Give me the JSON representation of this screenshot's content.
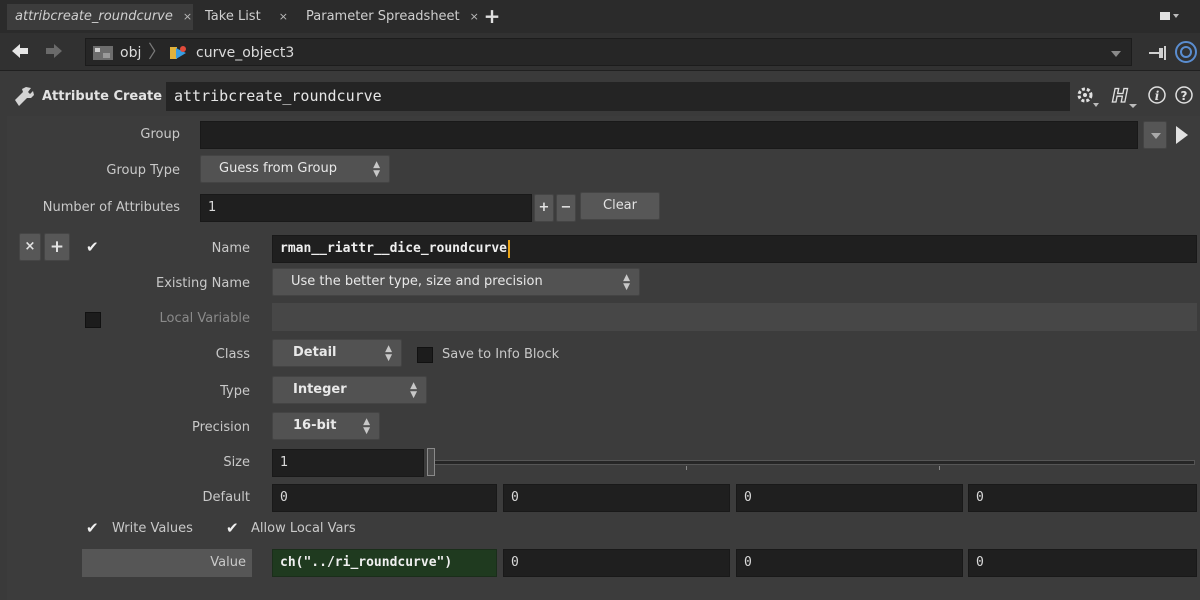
{
  "tabs": [
    {
      "label": "attribcreate_roundcurve",
      "active": true
    },
    {
      "label": "Take List",
      "active": false
    },
    {
      "label": "Parameter Spreadsheet",
      "active": false
    }
  ],
  "tab_close_glyph": "×",
  "tab_add_glyph": "+",
  "path": {
    "root": "obj",
    "node": "curve_object3"
  },
  "node_header": {
    "type_label": "Attribute Create",
    "node_name": "attribcreate_roundcurve"
  },
  "params": {
    "group": {
      "label": "Group",
      "value": ""
    },
    "group_type": {
      "label": "Group Type",
      "value": "Guess from Group"
    },
    "num_attributes": {
      "label": "Number of Attributes",
      "value": "1",
      "clear_label": "Clear"
    },
    "name": {
      "label": "Name",
      "value": "rman__riattr__dice_roundcurve"
    },
    "existing_name": {
      "label": "Existing Name",
      "value": "Use the better type, size and precision"
    },
    "local_variable": {
      "label": "Local Variable",
      "value": ""
    },
    "class": {
      "label": "Class",
      "value": "Detail",
      "save_info_label": "Save to Info Block"
    },
    "type": {
      "label": "Type",
      "value": "Integer"
    },
    "precision": {
      "label": "Precision",
      "value": "16-bit"
    },
    "size": {
      "label": "Size",
      "value": "1"
    },
    "default": {
      "label": "Default",
      "values": [
        "0",
        "0",
        "0",
        "0"
      ]
    },
    "write_values_label": "Write Values",
    "allow_local_vars_label": "Allow Local Vars",
    "value": {
      "label": "Value",
      "values": [
        "ch(\"../ri_roundcurve\")",
        "0",
        "0",
        "0"
      ]
    }
  },
  "colors": {
    "background": "#3a3a3a",
    "field": "#1f1f1f",
    "menu": "#525252",
    "expression_field": "#1f3a1f",
    "cursor": "#e8a317"
  },
  "icons": {
    "back": "back-arrow-icon",
    "forward": "forward-arrow-icon",
    "network": "network-icon",
    "curve": "curve-object-icon",
    "pin": "pin-icon",
    "link": "link-icon",
    "tool": "wrench-icon",
    "gear": "gear-icon",
    "help_h": "houdini-help-icon",
    "info": "info-icon",
    "help": "help-icon"
  }
}
